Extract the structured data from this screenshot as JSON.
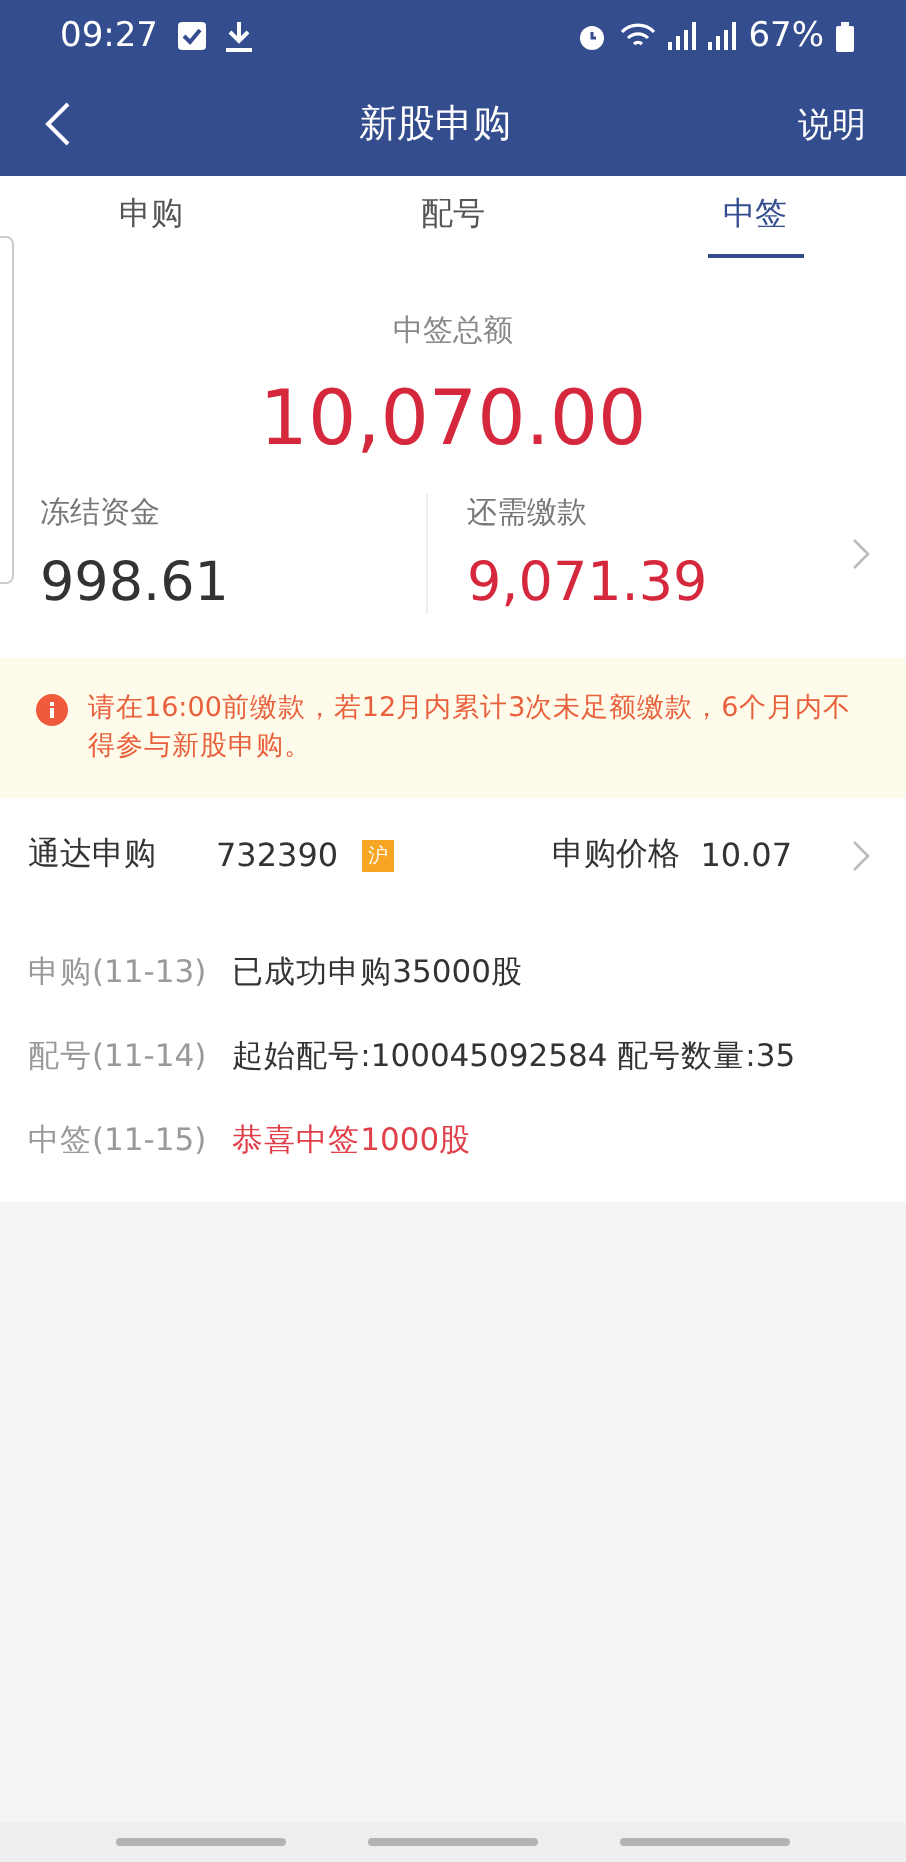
{
  "status_bar": {
    "time": "09:27",
    "battery": "67%"
  },
  "header": {
    "title": "新股申购",
    "action": "说明"
  },
  "tabs": [
    {
      "label": "申购",
      "selected": false
    },
    {
      "label": "配号",
      "selected": false
    },
    {
      "label": "中签",
      "selected": true
    }
  ],
  "summary": {
    "label": "中签总额",
    "amount": "10,070.00",
    "frozen": {
      "label": "冻结资金",
      "value": "998.61"
    },
    "due": {
      "label": "还需缴款",
      "value": "9,071.39"
    }
  },
  "notice": "请在16:00前缴款，若12月内累计3次未足额缴款，6个月内不得参与新股申购。",
  "stock": {
    "name": "通达申购",
    "code": "732390",
    "market": "沪",
    "price_label": "申购价格",
    "price": "10.07"
  },
  "timeline": [
    {
      "date": "申购(11-13)",
      "text": "已成功申购35000股",
      "kind": "normal"
    },
    {
      "date": "配号(11-14)",
      "text": "起始配号:100045092584 配号数量:35",
      "kind": "normal"
    },
    {
      "date": "中签(11-15)",
      "text": "恭喜中签1000股",
      "kind": "win"
    }
  ]
}
